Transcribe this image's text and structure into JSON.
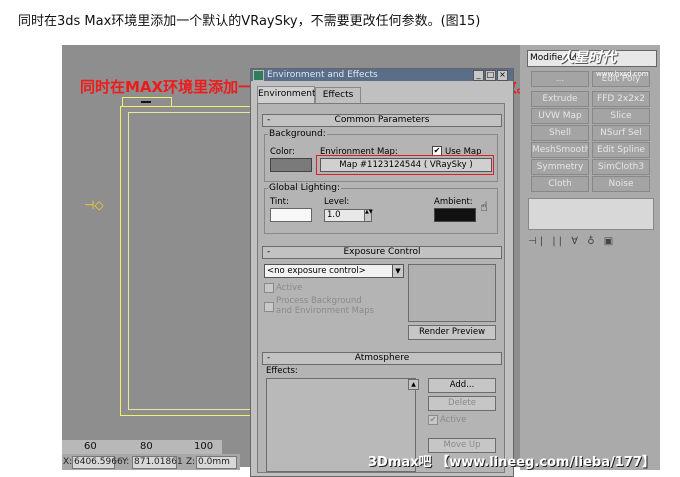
{
  "caption": "同时在3ds Max环境里添加一个默认的VRaySky，不需要更改任何参数。(图15)",
  "overlay_text": "同时在MAX环境里添加一个默认的VRSkay 不需要更改任何参数。",
  "ruler": {
    "ticks": [
      "60",
      "80",
      "100"
    ]
  },
  "statusbar": {
    "x_label": "X:",
    "x_value": "6406.5966",
    "y_label": "Y:",
    "y_value": "871.01861",
    "z_label": "Z:",
    "z_value": "0.0mm"
  },
  "command_panel": {
    "modifier_list": "Modifier Lis",
    "buttons": [
      "Extrude",
      "FFD 2x2x2",
      "UVW Map",
      "Slice",
      "Shell",
      "NSurf Sel",
      "MeshSmooth",
      "Edit Spline",
      "Symmetry",
      "SimCloth3",
      "Cloth",
      "Noise"
    ],
    "partial_buttons": [
      "...",
      "Edit Poly"
    ],
    "logo": "火星时代",
    "logo_sub": "www.hxsd.com"
  },
  "dialog": {
    "title": "Environment and Effects",
    "tabs": [
      "Environment",
      "Effects"
    ],
    "common": {
      "header": "Common Parameters",
      "collapse": "-",
      "background_group": "Background:",
      "color_label": "Color:",
      "env_map_label": "Environment Map:",
      "use_map_label": "Use Map",
      "use_map_checked": "✔",
      "env_map_button": "Map #1123124544  ( VRaySky )",
      "global_lighting_group": "Global Lighting:",
      "tint_label": "Tint:",
      "level_label": "Level:",
      "level_value": "1.0",
      "ambient_label": "Ambient:"
    },
    "exposure": {
      "header": "Exposure Control",
      "collapse": "-",
      "combo_value": "<no exposure control>",
      "active_label": "Active",
      "process_bg_line1": "Process Background",
      "process_bg_line2": "and Environment Maps",
      "render_preview": "Render Preview"
    },
    "atmosphere": {
      "header": "Atmosphere",
      "collapse": "-",
      "effects_label": "Effects:",
      "add": "Add...",
      "delete": "Delete",
      "active_label": "Active",
      "active_checked": "✔",
      "move_up": "Move Up"
    }
  },
  "footer_watermark": "3Dmax吧 【www.lineeg.com/lieba/177】",
  "colors": {
    "viewport_bg": "#8e8e8e",
    "overlay_red": "#ee1b1b",
    "selection_yellow": "#f2f06a",
    "highlight_box": "#e02020"
  }
}
